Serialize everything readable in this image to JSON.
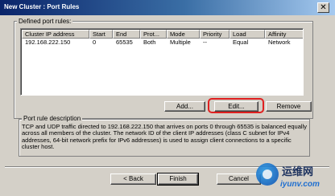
{
  "window": {
    "title": "New Cluster : Port Rules",
    "close_glyph": "✕"
  },
  "defined_rules": {
    "label": "Defined port rules:",
    "columns": [
      "Cluster IP address",
      "Start",
      "End",
      "Prot...",
      "Mode",
      "Priority",
      "Load",
      "Affinity"
    ],
    "rows": [
      [
        "192.168.222.150",
        "0",
        "65535",
        "Both",
        "Multiple",
        "--",
        "Equal",
        "Network"
      ]
    ]
  },
  "rule_buttons": {
    "add": "Add...",
    "edit": "Edit...",
    "remove": "Remove"
  },
  "description": {
    "label": "Port rule description",
    "text": "TCP and UDP traffic directed to 192.168.222.150 that arrives on ports 0 through 65535 is balanced equally across all members of the cluster. The network ID of the client IP addresses (class C subnet for IPv4 addresses, 64-bit network prefix for IPv6 addresses) is used to assign client connections to a specific cluster host."
  },
  "footer": {
    "back": "< Back",
    "finish": "Finish",
    "cancel": "Cancel"
  },
  "watermark": {
    "chinese": "运维网",
    "url": "iyunv.com"
  }
}
